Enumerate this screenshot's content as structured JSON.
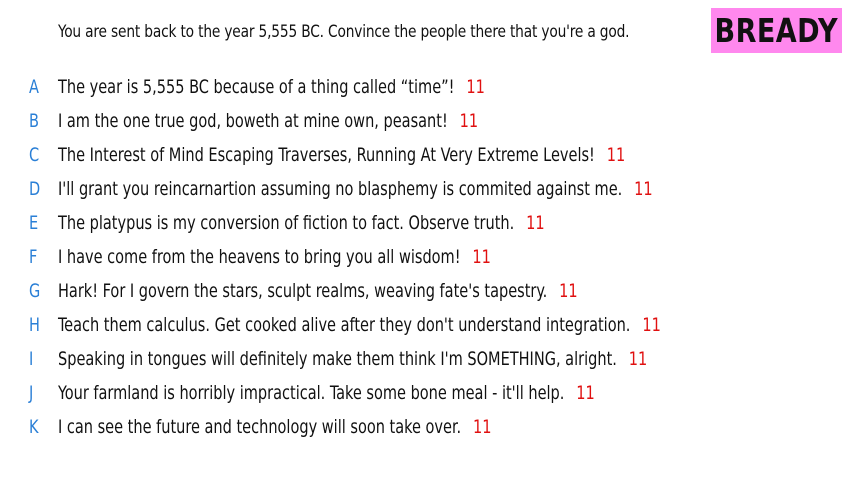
{
  "prompt": "You are sent back to the year 5,555 BC. Convince the people there that you're a god.",
  "player_tag": "BREADY",
  "answers": [
    {
      "letter": "A",
      "text": "The year is 5,555 BC because of a thing called “time”!",
      "score": "11"
    },
    {
      "letter": "B",
      "text": "I am the one true god, boweth at mine own, peasant!",
      "score": "11"
    },
    {
      "letter": "C",
      "text": "The Interest of Mind Escaping Traverses, Running At Very Extreme Levels!",
      "score": "11"
    },
    {
      "letter": "D",
      "text": "I'll grant you reincarnartion assuming no blasphemy is commited against me.",
      "score": "11"
    },
    {
      "letter": "E",
      "text": "The platypus is my conversion of fiction to fact. Observe truth.",
      "score": "11"
    },
    {
      "letter": "F",
      "text": "I have come from the heavens to bring you all wisdom!",
      "score": "11"
    },
    {
      "letter": "G",
      "text": "Hark! For I govern the stars, sculpt realms, weaving fate's tapestry.",
      "score": "11"
    },
    {
      "letter": "H",
      "text": "Teach them calculus. Get cooked alive after they don't understand integration.",
      "score": "11"
    },
    {
      "letter": "I",
      "text": "Speaking in tongues will definitely make them think I'm SOMETHING, alright.",
      "score": "11"
    },
    {
      "letter": "J",
      "text": "Your farmland is horribly impractical. Take some bone meal - it'll help.",
      "score": "11"
    },
    {
      "letter": "K",
      "text": "I can see the future and technology will soon take over.",
      "score": "11"
    }
  ],
  "colors": {
    "letter": "#2a7fd6",
    "score": "#e01010",
    "player_tag_bg": "#ff88ee"
  }
}
